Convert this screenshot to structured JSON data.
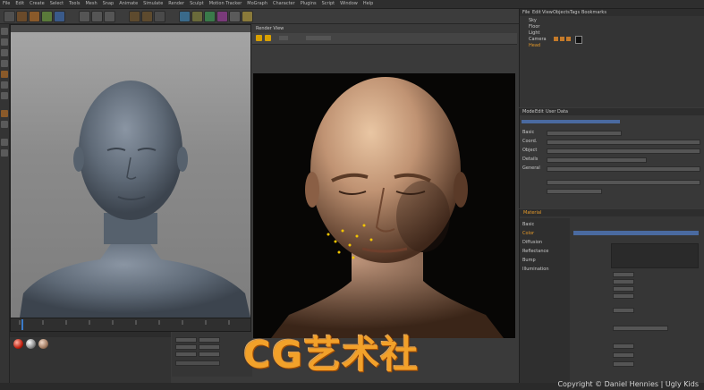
{
  "menu": [
    "File",
    "Edit",
    "Create",
    "Select",
    "Tools",
    "Mesh",
    "Snap",
    "Animate",
    "Simulate",
    "Render",
    "Sculpt",
    "Motion Tracker",
    "MoGraph",
    "Character",
    "Plugins",
    "Script",
    "Window",
    "Help"
  ],
  "objects": [
    "Sky",
    "Floor",
    "Light",
    "Camera",
    "Head"
  ],
  "object_tabs": [
    "File",
    "Edit",
    "View",
    "Objects",
    "Tags",
    "Bookmarks"
  ],
  "attr_tabs": [
    "Mode",
    "Edit",
    "User Data"
  ],
  "attr_rows": [
    "Basic",
    "Coord.",
    "Object",
    "Details",
    "General"
  ],
  "attr2_header": "Material",
  "attr2_tabs": [
    "Basic",
    "Color",
    "Diffusion",
    "Reflectance",
    "Bump",
    "Illumination"
  ],
  "render_toolbar": "Render View",
  "timeline_frames": [
    "0",
    "10",
    "20",
    "30",
    "40",
    "50",
    "60",
    "70",
    "80",
    "90"
  ],
  "watermark": "CG艺术社",
  "copyright": "Copyright © Daniel Hennies | Ugly Kids",
  "colors": {
    "accent": "#e69a2a",
    "watermark": "#f2a12a",
    "ui_bg": "#3a3a3a"
  },
  "icons": [
    "move-icon",
    "scale-icon",
    "rotate-icon",
    "undo-icon",
    "render-icon",
    "play-icon"
  ]
}
